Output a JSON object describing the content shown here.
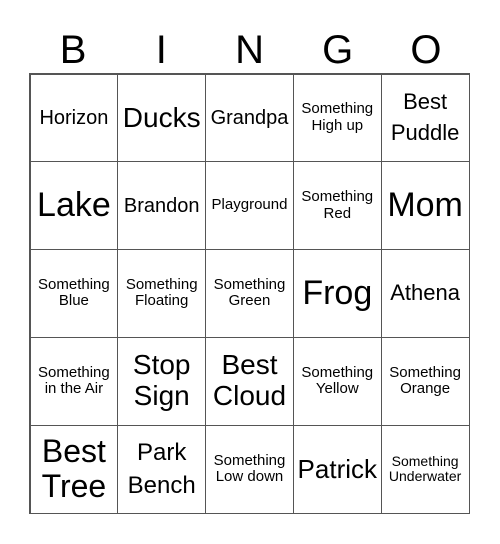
{
  "header": [
    "B",
    "I",
    "N",
    "G",
    "O"
  ],
  "cells": [
    [
      "Horizon",
      "Ducks",
      "Grandpa",
      "Something High up",
      "Best Puddle"
    ],
    [
      "Lake",
      "Brandon",
      "Playground",
      "Something Red",
      "Mom"
    ],
    [
      "Something Blue",
      "Something Floating",
      "Something Green",
      "Frog",
      "Athena"
    ],
    [
      "Something in the Air",
      "Stop Sign",
      "Best Cloud",
      "Something Yellow",
      "Something Orange"
    ],
    [
      "Best Tree",
      "Park Bench",
      "Something Low down",
      "Patrick",
      "Something Underwater"
    ]
  ]
}
